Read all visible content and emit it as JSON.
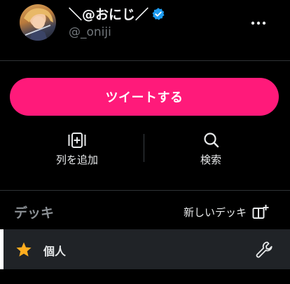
{
  "profile": {
    "display_name": "＼@おにじ／",
    "handle": "@_oniji",
    "verified": true
  },
  "compose": {
    "tweet_label": "ツイートする"
  },
  "actions": {
    "add_column_label": "列を追加",
    "search_label": "検索"
  },
  "decks": {
    "title": "デッキ",
    "new_deck_label": "新しいデッキ",
    "items": [
      {
        "name": "個人",
        "icon": "star-icon"
      }
    ]
  },
  "icons": {
    "more": "more-horizontal-icon",
    "add_column": "add-column-icon",
    "search": "search-icon",
    "new_deck": "new-deck-icon",
    "settings": "wrench-icon",
    "verified": "verified-badge-icon"
  },
  "colors": {
    "background": "#000000",
    "accent": "#ff1a7a",
    "verified": "#1d9bf0",
    "star": "#ffad1f",
    "selected_row": "#202327"
  }
}
